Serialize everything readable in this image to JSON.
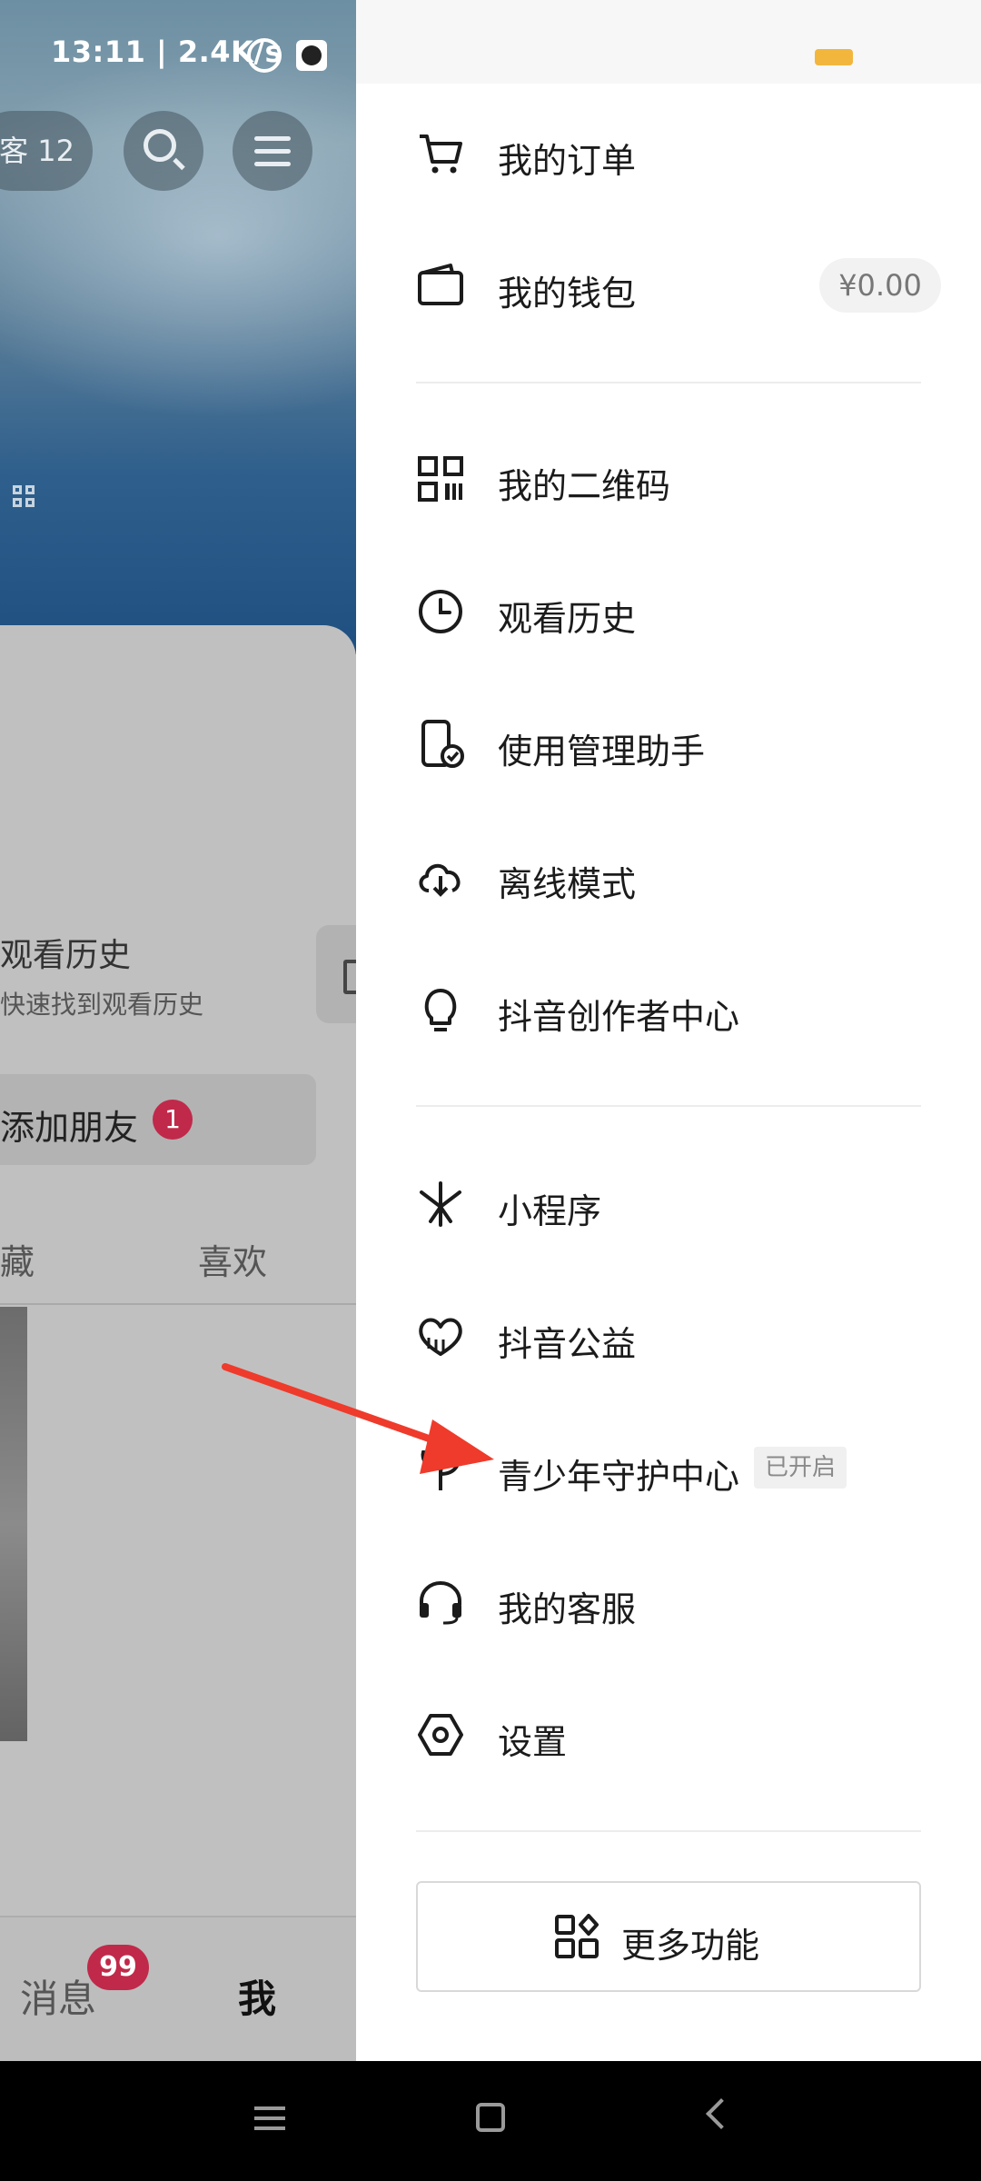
{
  "status_bar": {
    "time_speed": "13:11 | 2.4K/s"
  },
  "background_page": {
    "visitor_pill": "客 12",
    "history_card": {
      "title": "观看历史",
      "subtitle": "快速找到观看历史"
    },
    "add_friend": {
      "label": "添加朋友",
      "badge": "1"
    },
    "tabs": [
      "藏",
      "喜欢"
    ],
    "bottom_nav": {
      "messages": "消息",
      "messages_badge": "99",
      "me": "我"
    }
  },
  "drawer": {
    "items": [
      {
        "label": "我的订单",
        "icon": "cart-icon"
      },
      {
        "label": "我的钱包",
        "icon": "wallet-icon",
        "value": "¥0.00"
      },
      {
        "label": "我的二维码",
        "icon": "qr-code-icon"
      },
      {
        "label": "观看历史",
        "icon": "clock-icon"
      },
      {
        "label": "使用管理助手",
        "icon": "phone-check-icon"
      },
      {
        "label": "离线模式",
        "icon": "cloud-download-icon"
      },
      {
        "label": "抖音创作者中心",
        "icon": "lightbulb-icon"
      },
      {
        "label": "小程序",
        "icon": "mini-program-icon"
      },
      {
        "label": "抖音公益",
        "icon": "heart-charity-icon"
      },
      {
        "label": "青少年守护中心",
        "icon": "sprout-icon",
        "tag": "已开启"
      },
      {
        "label": "我的客服",
        "icon": "headset-icon"
      },
      {
        "label": "设置",
        "icon": "settings-hex-icon"
      }
    ],
    "more_button": {
      "label": "更多功能",
      "icon": "apps-icon"
    }
  },
  "colors": {
    "accent_red": "#c0294a",
    "arrow": "#ef3b2b",
    "battery": "#f3b63d"
  }
}
